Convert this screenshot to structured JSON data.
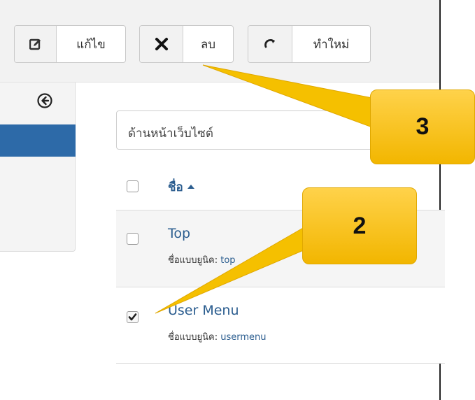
{
  "toolbar": {
    "edit": {
      "label": "แก้ไข",
      "icon": "edit-icon"
    },
    "delete": {
      "label": "ลบ",
      "icon": "close-icon"
    },
    "new": {
      "label": "ทำใหม่",
      "icon": "refresh-icon"
    }
  },
  "sidebar": {
    "toggle_icon": "arrow-circle-left-icon"
  },
  "filter": {
    "value": "ด้านหน้าเว็บไซต์"
  },
  "list": {
    "column_title": "ชื่อ",
    "items": [
      {
        "title": "Top",
        "alias_label": "ชื่อแบบยูนิค:",
        "alias": "top",
        "checked": false
      },
      {
        "title": "User Menu",
        "alias_label": "ชื่อแบบยูนิค:",
        "alias": "usermenu",
        "checked": true
      }
    ]
  },
  "callouts": [
    {
      "number": "3"
    },
    {
      "number": "2"
    }
  ],
  "colors": {
    "link": "#2b5d8f",
    "sidebar_active": "#2d6aa8",
    "callout": "#f5c000"
  }
}
